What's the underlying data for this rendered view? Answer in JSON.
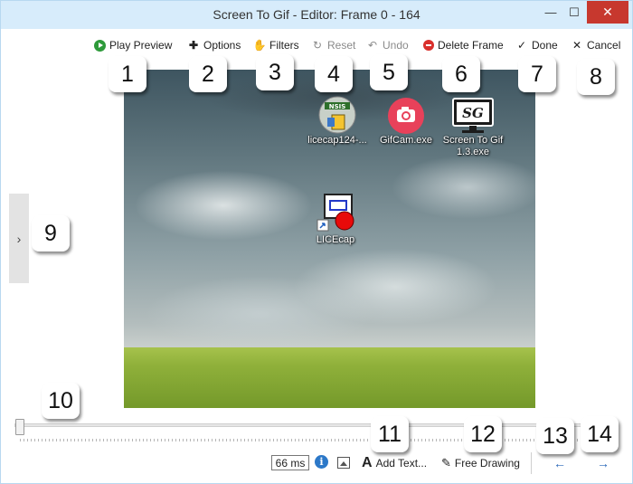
{
  "window": {
    "title": "Screen To Gif - Editor: Frame 0 - 164",
    "controls": {
      "minimize": "—",
      "maximize": "☐",
      "close": "✕"
    }
  },
  "toolbar": {
    "play_preview": "Play Preview",
    "options": "Options",
    "filters": "Filters",
    "reset": "Reset",
    "undo": "Undo",
    "delete_frame": "Delete Frame",
    "done": "Done",
    "cancel": "Cancel"
  },
  "callouts": [
    "1",
    "2",
    "3",
    "4",
    "5",
    "6",
    "7",
    "8",
    "9",
    "10",
    "11",
    "12",
    "13",
    "14"
  ],
  "frame": {
    "desktop_icons": [
      {
        "label": "licecap124-...",
        "icon": "installer-icon"
      },
      {
        "label": "GifCam.exe",
        "icon": "camera-icon"
      },
      {
        "label": "Screen To Gif\n1.3.exe",
        "icon": "screentogif-monitor-icon"
      },
      {
        "label": "LICEcap",
        "icon": "licecap-shortcut-icon"
      }
    ]
  },
  "side_panel": {
    "toggle": "›"
  },
  "timeline": {
    "current_frame": 0,
    "last_frame": 164
  },
  "bottom_bar": {
    "delay": "66 ms",
    "info": "i",
    "add_text": "Add Text...",
    "free_drawing": "Free Drawing",
    "prev": "←",
    "next": "→"
  },
  "colors": {
    "titlebar": "#d7ecfb",
    "close_button": "#c7382e",
    "play_green": "#2e9a3a",
    "delete_red": "#d9302c",
    "nav_blue": "#2866b8"
  }
}
